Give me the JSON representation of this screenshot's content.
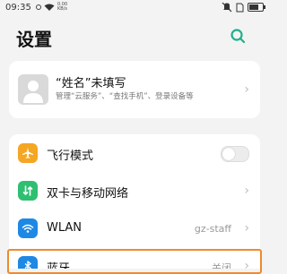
{
  "status_bar": {
    "time": "09:35",
    "speed_value": "0.00",
    "speed_unit": "KB/s"
  },
  "header": {
    "title": "设置",
    "search_icon": "search-icon",
    "accent_color": "#20b08a"
  },
  "profile": {
    "name": "“姓名”未填写",
    "subtitle": "管理“云服务”、“查找手机”、登录设备等",
    "avatar_icon": "person-icon"
  },
  "settings": {
    "items": [
      {
        "label": "飞行模式",
        "icon": "airplane-icon",
        "icon_color": "#f5a623",
        "control": "toggle",
        "toggle_on": false
      },
      {
        "label": "双卡与移动网络",
        "icon": "sim-data-icon",
        "icon_color": "#2fbf71",
        "control": "chevron"
      },
      {
        "label": "WLAN",
        "icon": "wifi-icon",
        "icon_color": "#1e88e5",
        "value": "gz-staff",
        "control": "chevron"
      },
      {
        "label": "蓝牙",
        "icon": "bluetooth-icon",
        "icon_color": "#1e88e5",
        "value": "关闭",
        "control": "chevron"
      }
    ]
  },
  "highlight_color": "#f08a2c"
}
